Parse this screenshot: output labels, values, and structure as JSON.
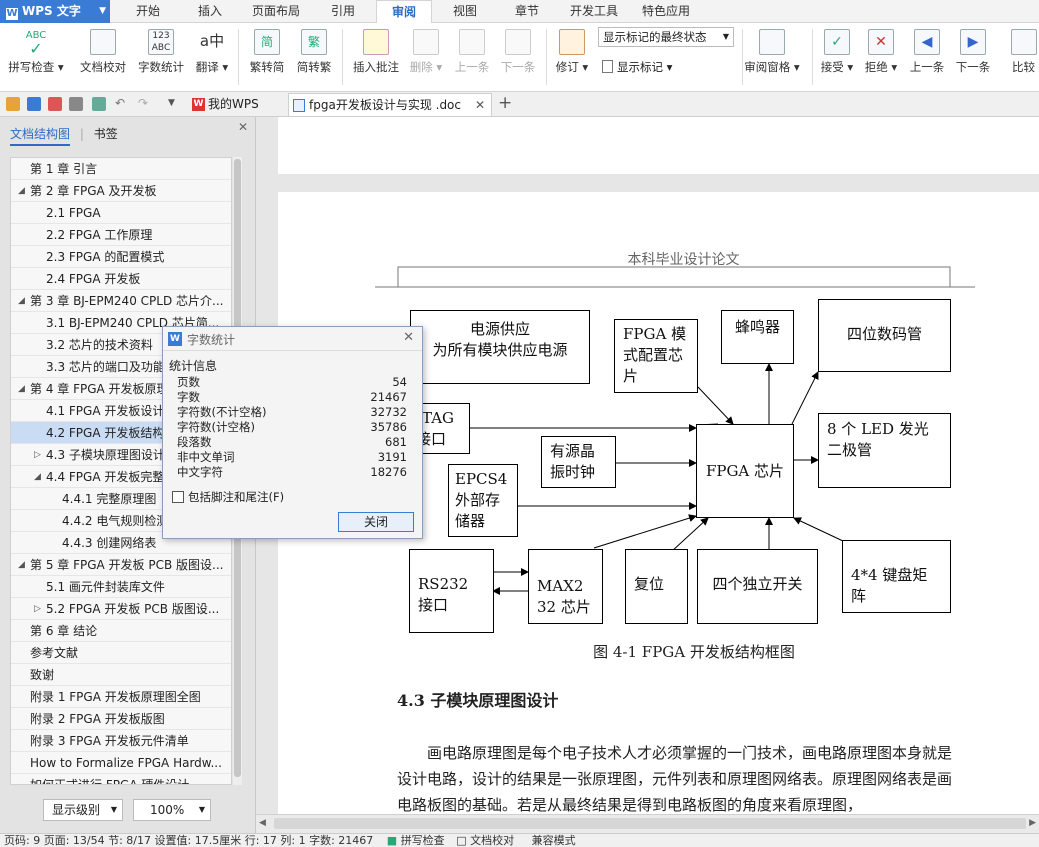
{
  "app": {
    "name": "WPS 文字"
  },
  "menu": [
    "开始",
    "插入",
    "页面布局",
    "引用",
    "审阅",
    "视图",
    "章节",
    "开发工具",
    "特色应用"
  ],
  "ribbon": {
    "spell_check": "拼写检查",
    "doc_proof": "文档校对",
    "word_count": "字数统计",
    "translate": "翻译",
    "to_simplified": "繁转简",
    "to_traditional": "简转繁",
    "insert_comment": "插入批注",
    "delete": "删除",
    "prev": "上一条",
    "next": "下一条",
    "revise": "修订",
    "markup_select": "显示标记的最终状态",
    "show_markup": "显示标记",
    "review_pane": "审阅窗格",
    "accept": "接受",
    "reject": "拒绝",
    "prev2": "上一条",
    "next2": "下一条",
    "compare": "比较"
  },
  "tabs": {
    "home": "我的WPS",
    "doc": "fpga开发板设计与实现 .doc"
  },
  "sidebar": {
    "tab_toc": "文档结构图",
    "tab_bookmark": "书签",
    "toc": [
      "第 1 章  引言",
      "第 2 章  FPGA 及开发板",
      "2.1 FPGA",
      "2.2 FPGA 工作原理",
      "2.3 FPGA 的配置模式",
      "2.4 FPGA 开发板",
      "第 3 章  BJ-EPM240 CPLD 芯片介...",
      "3.1 BJ-EPM240 CPLD 芯片简...",
      "3.2 芯片的技术资料",
      "3.3 芯片的端口及功能",
      "第 4 章  FPGA 开发板原理",
      "4.1 FPGA 开发板设计",
      "4.2 FPGA 开发板结构",
      "4.3 子模块原理图设计",
      "4.4 FPGA 开发板完整",
      "4.4.1  完整原理图",
      "4.4.2 电气规则检测",
      "4.4.3  创建网络表",
      "第 5 章  FPGA 开发板 PCB 版图设...",
      "5.1 画元件封装库文件",
      "5.2 FPGA 开发板 PCB 版图设...",
      "第 6 章  结论",
      "参考文献",
      "致谢",
      "附录 1    FPGA 开发板原理图全图",
      "附录 2    FPGA 开发板版图",
      "附录 3    FPGA 开发板元件清单",
      "How to Formalize FPGA Hardw...",
      "如何正式进行 FPGA 硬件设计"
    ],
    "level_select": "显示级别",
    "zoom_select": "100%"
  },
  "document": {
    "header": "本科毕业设计论文",
    "blocks": {
      "power": "电源供应\n为所有模块供应电源",
      "config": "FPGA 模式配置芯片",
      "buzzer": "蜂鸣器",
      "seg": "四位数码管",
      "jtag": "JTAG\n接口",
      "osc": "有源晶振时钟",
      "fpga": "FPGA 芯片",
      "led": "8 个 LED 发光二极管",
      "epcs": "EPCS4\n外部存储器",
      "rs232": "RS232 接口",
      "max": "MAX2\n32 芯片",
      "reset": "复位",
      "sw": "四个独立开关",
      "key": "4*4 键盘矩阵"
    },
    "caption": "图 4-1    FPGA 开发板结构框图",
    "section": "4.3 子模块原理图设计",
    "paragraph": "画电路原理图是每个电子技术人才必须掌握的一门技术，画电路原理图本身就是设计电路，设计的结果是一张原理图，元件列表和原理图网络表。原理图网络表是画电路板图的基础。若是从最终结果是得到电路板图的角度来看原理图，"
  },
  "dialog": {
    "title": "字数统计",
    "section": "统计信息",
    "stats": [
      {
        "label": "页数",
        "value": "54"
      },
      {
        "label": "字数",
        "value": "21467"
      },
      {
        "label": "字符数(不计空格)",
        "value": "32732"
      },
      {
        "label": "字符数(计空格)",
        "value": "35786"
      },
      {
        "label": "段落数",
        "value": "681"
      },
      {
        "label": "非中文单词",
        "value": "3191"
      },
      {
        "label": "中文字符",
        "value": "18276"
      }
    ],
    "checkbox": "包括脚注和尾注(F)",
    "close": "关闭"
  },
  "status": {
    "text": "页码: 9   页面: 13/54   节: 8/17   设置值: 17.5厘米   行: 17   列: 1   字数: 21467",
    "spell": "拼写检查",
    "proof": "文档校对",
    "compat": "兼容模式"
  }
}
